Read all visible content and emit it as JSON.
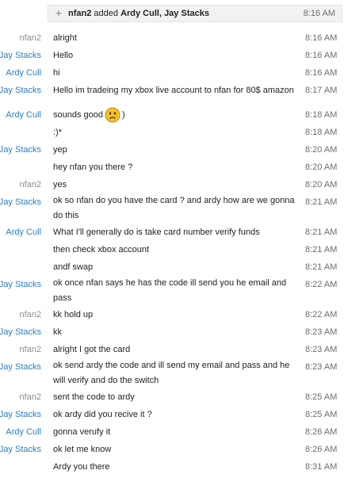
{
  "system_event": {
    "actor": "nfan2",
    "action": "added",
    "targets": "Ardy Cull, Jay Stacks",
    "time": "8:16 AM"
  },
  "messages": [
    {
      "sender": "nfan2",
      "text": "alright",
      "time": "8:16 AM",
      "role": "nfan"
    },
    {
      "sender": "Jay Stacks",
      "text": "Hello",
      "time": "8:16 AM",
      "role": "jay"
    },
    {
      "sender": "Ardy Cull",
      "text": "hi",
      "time": "8:16 AM",
      "role": "ardy"
    },
    {
      "sender": "Jay Stacks",
      "text": "Hello im tradeing my xbox live account to nfan for 80$ amazon",
      "time": "8:17 AM",
      "role": "jay"
    },
    {
      "sender": "Ardy Cull",
      "text": "sounds good",
      "text_after": ")",
      "emoticon": "worried-face-icon",
      "time": "8:18 AM",
      "role": "ardy"
    },
    {
      "sender": "",
      "text": ":)*",
      "time": "8:18 AM",
      "role": "ardy"
    },
    {
      "sender": "Jay Stacks",
      "text": "yep",
      "time": "8:20 AM",
      "role": "jay"
    },
    {
      "sender": "",
      "text": "hey nfan you there ?",
      "time": "8:20 AM",
      "role": "jay"
    },
    {
      "sender": "nfan2",
      "text": "yes",
      "time": "8:20 AM",
      "role": "nfan"
    },
    {
      "sender": "Jay Stacks",
      "text": "ok so nfan do you have the card ? and ardy how are we gonna do this",
      "time": "8:21 AM",
      "role": "jay"
    },
    {
      "sender": "Ardy Cull",
      "text": "What I'll generally do is take card number verify funds",
      "time": "8:21 AM",
      "role": "ardy"
    },
    {
      "sender": "",
      "text": "then check xbox account",
      "time": "8:21 AM",
      "role": "ardy"
    },
    {
      "sender": "",
      "text": "andf swap",
      "time": "8:21 AM",
      "role": "ardy"
    },
    {
      "sender": "Jay Stacks",
      "text": "ok once nfan says he has the code ill send you he email and pass",
      "time": "8:22 AM",
      "role": "jay"
    },
    {
      "sender": "nfan2",
      "text": "kk hold up",
      "time": "8:22 AM",
      "role": "nfan"
    },
    {
      "sender": "Jay Stacks",
      "text": "kk",
      "time": "8:23 AM",
      "role": "jay"
    },
    {
      "sender": "nfan2",
      "text": "alright I got the card",
      "time": "8:23 AM",
      "role": "nfan"
    },
    {
      "sender": "Jay Stacks",
      "text": "ok send ardy the code and ill send my email and pass and he will verify and do the switch",
      "time": "8:23 AM",
      "role": "jay"
    },
    {
      "sender": "nfan2",
      "text": "sent the code to ardy",
      "time": "8:25 AM",
      "role": "nfan"
    },
    {
      "sender": "Jay Stacks",
      "text": "ok ardy did you recive it ?",
      "time": "8:25 AM",
      "role": "jay"
    },
    {
      "sender": "Ardy Cull",
      "text": "gonna verufy it",
      "time": "8:26 AM",
      "role": "ardy"
    },
    {
      "sender": "Jay Stacks",
      "text": "ok let me know",
      "time": "8:26 AM",
      "role": "jay"
    },
    {
      "sender": "",
      "text": "Ardy you there",
      "time": "8:31 AM",
      "role": "jay"
    }
  ],
  "colors": {
    "link_blue": "#2a7fc0",
    "grey_name": "#8c8c8c",
    "timestamp": "#6d6d6d",
    "emoticon_face": "#f6c026"
  }
}
